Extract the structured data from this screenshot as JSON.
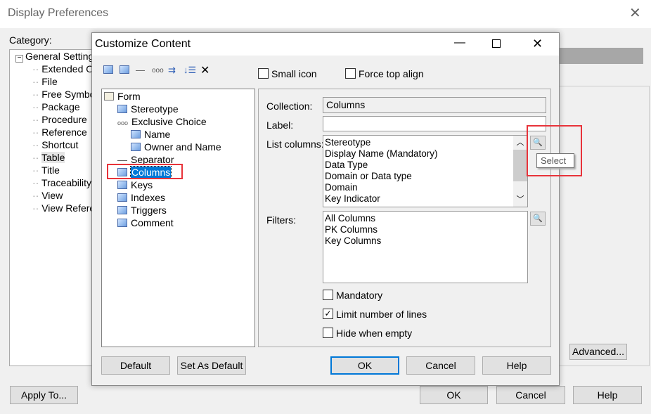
{
  "outer": {
    "title": "Display Preferences",
    "category_label": "Category:",
    "tree": {
      "root": "General Setting",
      "children": [
        "Extended Ob",
        "File",
        "Free Symbo",
        "Package",
        "Procedure",
        "Reference",
        "Shortcut",
        "Table",
        "Title",
        "Traceability",
        "View",
        "View Refere"
      ],
      "selected": "Table"
    },
    "advanced": "Advanced...",
    "apply_to": "Apply To...",
    "ok": "OK",
    "cancel": "Cancel",
    "help": "Help"
  },
  "dialog": {
    "title": "Customize Content",
    "toolbar": [
      "add-attribute-icon",
      "add-collection-icon",
      "separator-icon",
      "exclusive-choice-icon",
      "indent-icon",
      "move-icon",
      "delete-icon"
    ],
    "small_icon": "Small icon",
    "force_top_align": "Force top align",
    "tree": [
      {
        "label": "Form",
        "level": 0
      },
      {
        "label": "Stereotype",
        "level": 1
      },
      {
        "label": "Exclusive Choice",
        "level": 1
      },
      {
        "label": "Name",
        "level": 2
      },
      {
        "label": "Owner and Name",
        "level": 2
      },
      {
        "label": "Separator",
        "level": 1
      },
      {
        "label": "Columns",
        "level": 1,
        "selected": true
      },
      {
        "label": "Keys",
        "level": 1
      },
      {
        "label": "Indexes",
        "level": 1
      },
      {
        "label": "Triggers",
        "level": 1
      },
      {
        "label": "Comment",
        "level": 1
      }
    ],
    "collection_label": "Collection:",
    "collection_value": "Columns",
    "label_label": "Label:",
    "label_value": "",
    "list_columns_label": "List columns:",
    "list_columns": [
      "Stereotype",
      "Display Name (Mandatory)",
      "Data Type",
      "Domain or Data type",
      "Domain",
      "Key Indicator"
    ],
    "select_tooltip": "Select",
    "filters_label": "Filters:",
    "filters": [
      "All Columns",
      "PK Columns",
      "Key Columns"
    ],
    "mandatory": "Mandatory",
    "mandatory_checked": false,
    "limit_lines": "Limit number of lines",
    "limit_lines_checked": true,
    "hide_empty": "Hide when empty",
    "hide_empty_checked": false,
    "default": "Default",
    "set_as_default": "Set As Default",
    "ok": "OK",
    "cancel": "Cancel",
    "help": "Help"
  },
  "colors": {
    "selection": "#0078d7",
    "highlight_box": "#e8333a"
  }
}
